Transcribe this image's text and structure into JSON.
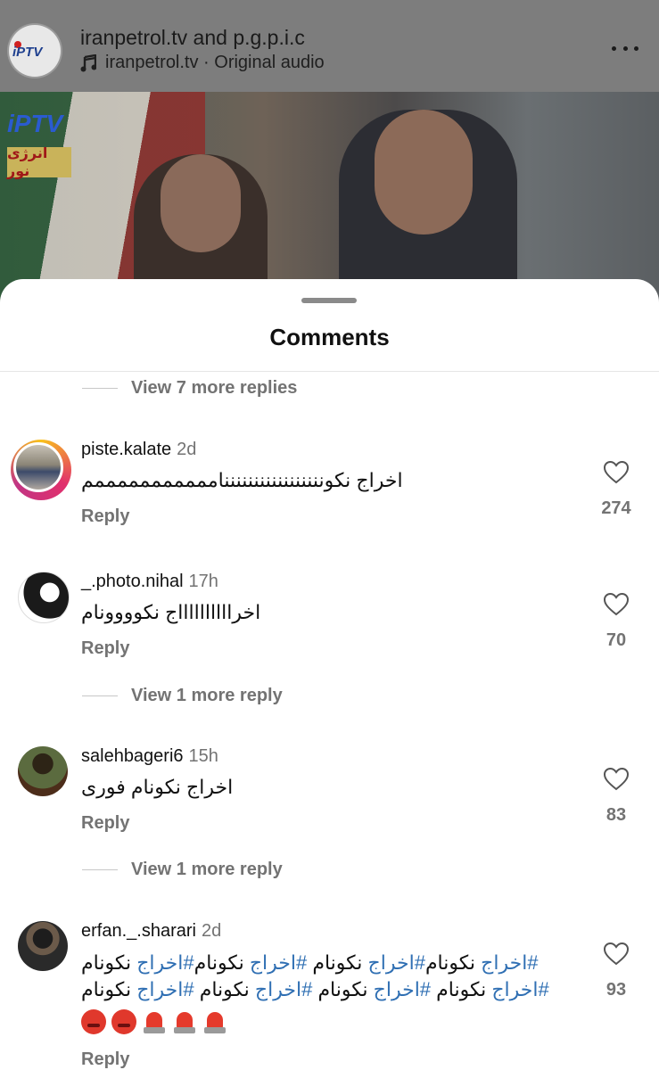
{
  "header": {
    "title": "iranpetrol.tv and p.g.p.i.c",
    "audio": "iranpetrol.tv · Original audio",
    "avatar_logo": "iPTV"
  },
  "video": {
    "badge_iptv": "iPTV",
    "badge_noor": "انرژی نور"
  },
  "sheet": {
    "title": "Comments",
    "top_view_replies": "View 7 more replies"
  },
  "comments": [
    {
      "username": "piste.kalate",
      "time": "2d",
      "text": "اخراج نکونننننننننننننننننامممممممممممم",
      "reply": "Reply",
      "likes": "274"
    },
    {
      "username": "_.photo.nihal",
      "time": "17h",
      "text": "اخرااااااااااج نکوووونام",
      "reply": "Reply",
      "likes": "70",
      "view_replies": "View 1 more reply"
    },
    {
      "username": "salehbageri6",
      "time": "15h",
      "text": "اخراج نکونام فوری",
      "reply": "Reply",
      "likes": "83",
      "view_replies": "View 1 more reply"
    },
    {
      "username": "erfan._.sharari",
      "time": "2d",
      "line1": {
        "p1": "#اخراج",
        "p2": " نکونام",
        "p3": "#اخراج",
        "p4": " نکونام ",
        "p5": "#اخراج",
        "p6": " نکونام",
        "p7": "#اخراج",
        "p8": " نکونام"
      },
      "line2": {
        "p1": "#اخراج",
        "p2": " نکونام ",
        "p3": "#اخراج",
        "p4": " نکونام ",
        "p5": "#اخراج",
        "p6": " نکونام ",
        "p7": "#اخراج",
        "p8": " نکونام"
      },
      "emojis": [
        "angry-face-icon",
        "angry-face-icon",
        "siren-icon",
        "siren-icon",
        "siren-icon"
      ],
      "reply": "Reply",
      "likes": "93"
    }
  ],
  "colors": {
    "hashtag": "#2f6fb3",
    "muted": "#737373"
  }
}
